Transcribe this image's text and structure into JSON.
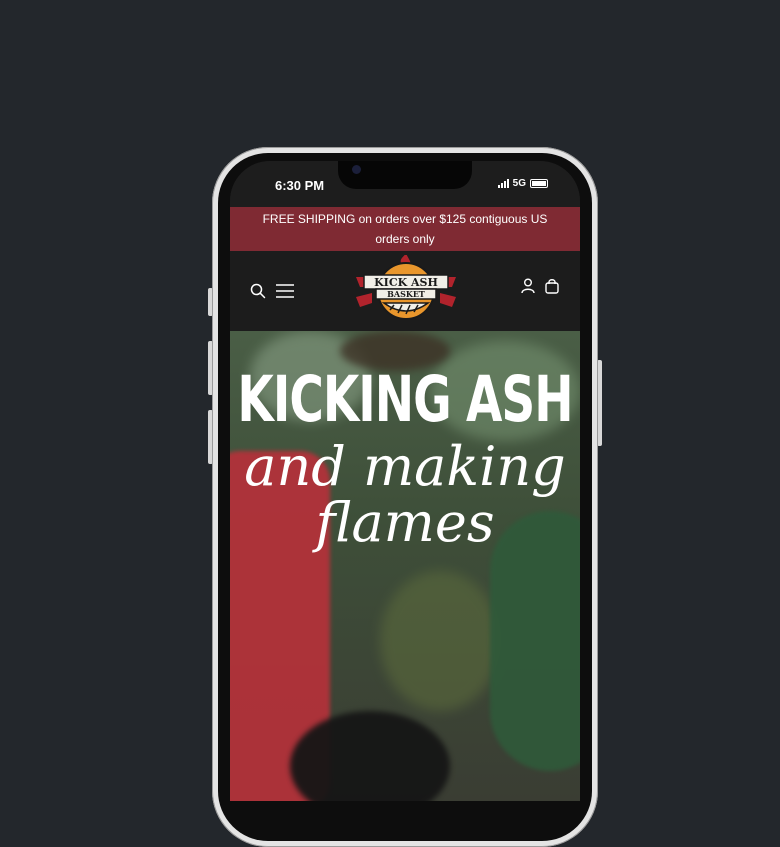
{
  "status_bar": {
    "time": "6:30 PM",
    "network": "5G"
  },
  "announcement": {
    "text": "FREE SHIPPING on orders over $125 contiguous US orders only"
  },
  "header": {
    "logo": {
      "line1": "KICK ASH",
      "line2": "BASKET"
    },
    "icons": [
      "search-icon",
      "menu-icon",
      "account-icon",
      "cart-icon"
    ]
  },
  "hero": {
    "title": "KICKING ASH",
    "script_line1": "and making",
    "script_line2": "flames"
  },
  "colors": {
    "announcement_bg": "#7f2a33",
    "header_bg": "#1c1c1c",
    "page_bg": "#23272c",
    "logo_orange": "#e9962c",
    "logo_red": "#b1232c"
  }
}
